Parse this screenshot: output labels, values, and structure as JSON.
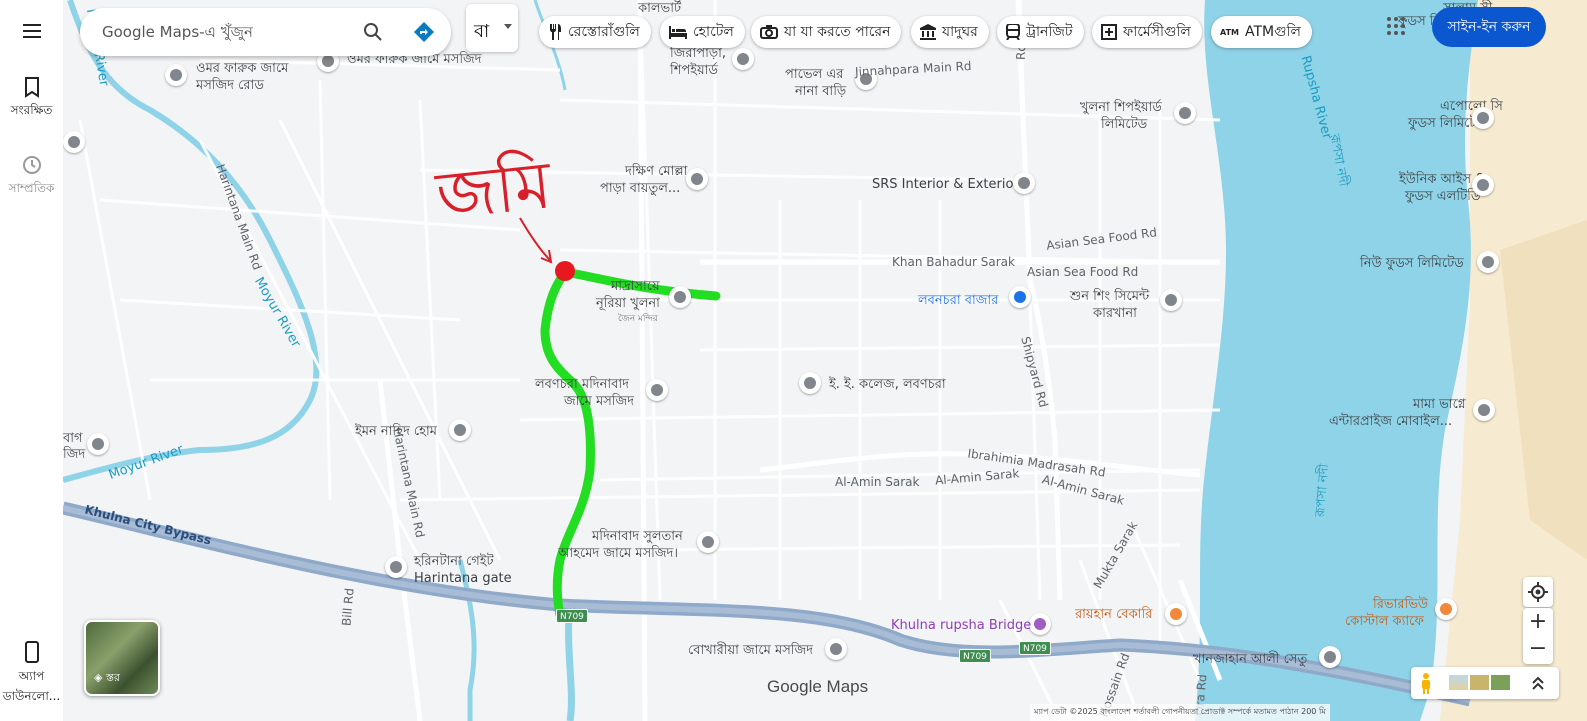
{
  "search": {
    "placeholder": "Google Maps-এ খুঁজুন",
    "lang_label": "বা"
  },
  "sidebar": {
    "saved_label": "সংরক্ষিত",
    "recent_label": "সাম্প্রতিক",
    "app_label_line1": "অ্যাপ",
    "app_label_line2": "ডাউনলো..."
  },
  "chips": [
    {
      "label": "রেস্তোরাঁগুলি",
      "icon": "restaurant-icon"
    },
    {
      "label": "হোটেল",
      "icon": "hotel-icon"
    },
    {
      "label": "যা যা করতে পারেন",
      "icon": "camera-icon"
    },
    {
      "label": "যাদুঘর",
      "icon": "museum-icon"
    },
    {
      "label": "ট্রানজিট",
      "icon": "transit-icon"
    },
    {
      "label": "ফার্মেসীগুলি",
      "icon": "pharmacy-icon"
    },
    {
      "label": "ATMগুলি",
      "icon": "atm-icon"
    }
  ],
  "signin_label": "সাইন-ইন করুন",
  "annotation": {
    "handwritten_text": "জমি",
    "route_color": "#22dd22",
    "marker_color": "#e5191f",
    "ink_color": "#d8202a"
  },
  "places": {
    "kalbhat": "কালভার্ট",
    "omar_farooq_1": "ওমর ফারুক জামে",
    "omar_farooq_2": "মসজিদ রোড",
    "omar_farooq_mosque": "ওমর ফারুক জামে মসজিদ",
    "jirapara_1": "জিরাপাড়া,",
    "jirapara_2": "শিপইয়ার্ড",
    "pavel_1": "পাভেল এর",
    "pavel_2": "নানা বাড়ি",
    "khulna_shipyard_1": "খুলনা শিপইয়ার্ড",
    "khulna_shipyard_2": "লিমিটেড",
    "dakshin_1": "দক্ষিণ মোল্লা",
    "dakshin_2": "পাড়া বায়তুল...",
    "srs": "SRS Interior & Exterior",
    "madrasa_1": "মাদ্রাসায়ে",
    "madrasa_2": "নূরিয়া খুলনা",
    "madrasa_3": "জৈন মন্দির",
    "labanchara_bazar": "লবনচরা বাজার",
    "shun_shing_1": "শুন শিং সিমেন্ট",
    "shun_shing_2": "কারখানা",
    "labanchara_madinabad_1": "লবণচরা মদিনাবাদ",
    "labanchara_madinabad_2": "জামে মসজিদ",
    "ee_college": "ই. ই. কলেজ, লবণচরা",
    "iman_nahid": "ইমন নাহিদ হোম",
    "madinabad_sultan_1": "মদিনাবাদ সুলতান",
    "madinabad_sultan_2": "আহমেদ জামে মসজিদ।",
    "harintana_1": "হরিনটানা গেইট",
    "harintana_2": "Harintana gate",
    "khulna_rupsha_bridge": "Khulna rupsha Bridge",
    "raihan_bakery": "রায়হান বেকারি",
    "bokhariya": "বোখারীয়া জামে মসজিদ",
    "khan_jahan_bridge": "খানজাহান আলী সেতু",
    "riverview_1": "রিভারভিউ",
    "riverview_2": "কোস্টাল ক্যাফে",
    "salam_1": "সালাম সী",
    "salam_2": "ফুডস লিমিটেড",
    "apollo_1": "এপোলো সি",
    "apollo_2": "ফুডস লিমিটেড",
    "unique_1": "ইউনিক আইস &",
    "unique_2": "ফুডস এলটিডি",
    "new_foods": "নিউ ফুডস লিমিটেড",
    "mama_bhagne_1": "মামা ভাগ্নে",
    "mama_bhagne_2": "এন্টারপ্রাইজ মোবাইল...",
    "left_edge_1": "বাগ",
    "left_edge_2": "জিদ"
  },
  "roads": {
    "jinnahpara": "Jinnahpara Main Rd",
    "shipyard_rd_top": "Rd",
    "khan_bahadur": "Khan Bahadur Sarak",
    "asian_sea_food_1": "Asian Sea Food Rd",
    "asian_sea_food_2": "Asian Sea Food Rd",
    "shipyard_rd": "Shipyard Rd",
    "ibrahimia": "Ibrahimia Madrasah Rd",
    "al_amin_1": "Al-Amin Sarak",
    "al_amin_2": "Al-Amin Sarak",
    "al_amin_3": "Al-Amin Sarak",
    "harintana_main_1": "Harintana Main Rd",
    "harintana_main_2": "Harintana Main Rd",
    "bypass": "Khulna City Bypass",
    "mukta": "Mukta Sarak",
    "hossain": "Hossain Rd",
    "bill": "Bill Rd",
    "ora": "Ora Rd"
  },
  "rivers": {
    "moyur_1": "Moyur River",
    "moyur_2": "Moyur River",
    "moyur_3": "Moyur River",
    "rupsha_en": "Rupsha River",
    "rupsha_bn": "রূপসা নদী",
    "rupsha_bn_2": "রূপসা নদী"
  },
  "shields": {
    "n709_a": "N709",
    "n709_b": "N709",
    "n709_c": "N709"
  },
  "branding": "Google Maps",
  "footer": "ম্যাপ ডেটা ©2025   বাংলাদেশ   শর্তাবলী   গোপনীয়তা   প্রোডাক্ট সম্পর্কে মতামত পাঠান   200 মি",
  "colors": {
    "water": "#8fd3e8",
    "highway": "#8fa9c9",
    "road": "#ffffff",
    "land": "#f3f4f6",
    "sand": "#f5e7c9"
  }
}
